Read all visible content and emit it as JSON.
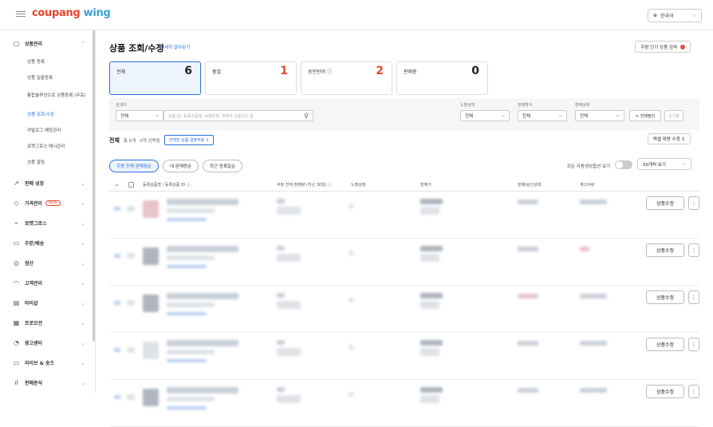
{
  "app": {
    "logo_main": "coupang",
    "logo_sub": "wing",
    "language": "한국어"
  },
  "sidebar": {
    "groups": [
      {
        "icon": "box-icon",
        "label": "상품관리",
        "expanded": true,
        "badge": null,
        "items": [
          {
            "label": "상품 등록",
            "active": false
          },
          {
            "label": "상품 일괄등록",
            "active": false
          },
          {
            "label": "통합솔루션으로 상품등록 (무료)",
            "active": false
          },
          {
            "label": "상품 조회/수정",
            "active": true
          },
          {
            "label": "카탈로그 매칭관리",
            "active": false
          },
          {
            "label": "로켓그로스 메시관리",
            "active": false
          },
          {
            "label": "상품 알림",
            "active": false
          }
        ]
      },
      {
        "icon": "trend-icon",
        "label": "판매 성장",
        "badge": null
      },
      {
        "icon": "price-tag-icon",
        "label": "가격관리",
        "badge": "NEW"
      },
      {
        "icon": "rocket-icon",
        "label": "로켓그로스",
        "badge": null
      },
      {
        "icon": "truck-icon",
        "label": "주문/배송",
        "badge": null
      },
      {
        "icon": "coin-icon",
        "label": "정산",
        "badge": null
      },
      {
        "icon": "headset-icon",
        "label": "고객관리",
        "badge": null
      },
      {
        "icon": "shop-icon",
        "label": "마이샵",
        "badge": null
      },
      {
        "icon": "promo-icon",
        "label": "프로모션",
        "badge": null
      },
      {
        "icon": "ad-icon",
        "label": "광고센터",
        "badge": null
      },
      {
        "icon": "live-icon",
        "label": "라이브 & 숏츠",
        "badge": null
      },
      {
        "icon": "chart-icon",
        "label": "판매분석",
        "badge": null
      }
    ]
  },
  "page": {
    "title": "상품 조회/수정",
    "help_link": "자세히 알아보기",
    "popular_button": "쿠팡 인기 상품 검색",
    "stats": [
      {
        "label": "전체",
        "value": "6",
        "active": true,
        "red": false
      },
      {
        "label": "품절",
        "value": "1",
        "active": false,
        "red": true
      },
      {
        "label": "승인반려 ⓘ",
        "value": "2",
        "active": false,
        "red": true
      },
      {
        "label": "판매중",
        "value": "0",
        "active": false,
        "red": false
      }
    ],
    "filters": {
      "search_label": "검색어",
      "search_type": "전체",
      "search_placeholder": "상품 ID, 등록상품명, 브랜드명, 판매자 상품코드 등",
      "exposure_label": "노출상태",
      "exposure_value": "전체",
      "sales_method_label": "판매방식",
      "sales_method_value": "전체",
      "sales_status_label": "판매상태",
      "sales_status_value": "전체",
      "detail_filter": "≒ 전체필터",
      "reset": "초기화"
    },
    "summary": {
      "total_label": "전체",
      "count": "총 6개",
      "selected": "0개 선택됨",
      "bulk_button": "선택한 상품 일괄적용 ↕"
    },
    "excel_button": "엑셀 대량 수정 ↕",
    "sort_pills": [
      {
        "label": "쿠팡 전체 판매량순",
        "on": true
      },
      {
        "label": "내 판매량순",
        "on": false
      },
      {
        "label": "최근 등록일순",
        "on": false
      }
    ],
    "auto_option_label": "모든 자동생성옵션 보기",
    "per_page": "50개씩 보기",
    "columns": {
      "product": "등록상품명 / 등록상품 ID ⓘ",
      "sales": "쿠팡 전체 판매량 (지난 30일) ⓘ",
      "exposure": "노출상태",
      "price": "판매가",
      "approval": "판매/승인상태",
      "stock": "재고수량"
    },
    "row_edit_label": "상품수정",
    "row_more_label": "⋮",
    "rows": [
      {},
      {},
      {},
      {},
      {}
    ]
  },
  "colors": {
    "accent": "#2b6fdc",
    "brand_red": "#e4462e",
    "brand_blue": "#3aa0d8"
  }
}
